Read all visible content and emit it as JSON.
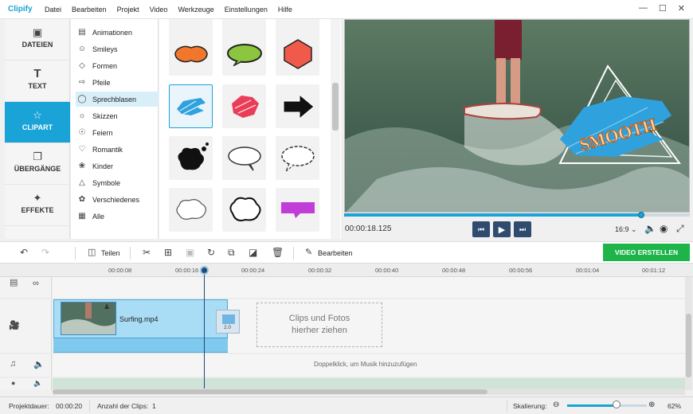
{
  "app": {
    "title": "Clipify"
  },
  "menu": [
    "Datei",
    "Bearbeiten",
    "Projekt",
    "Video",
    "Werkzeuge",
    "Einstellungen",
    "Hilfe"
  ],
  "window_controls": [
    "minimize-icon",
    "maximize-icon",
    "close-icon"
  ],
  "nav": [
    {
      "label": "DATEIEN",
      "icon": "image-icon",
      "active": false
    },
    {
      "label": "TEXT",
      "icon": "text-icon",
      "active": false
    },
    {
      "label": "CLIPART",
      "icon": "star-icon",
      "active": true
    },
    {
      "label": "ÜBERGÄNGE",
      "icon": "transition-icon",
      "active": false
    },
    {
      "label": "EFFEKTE",
      "icon": "magic-wand-icon",
      "active": false
    }
  ],
  "categories": [
    {
      "label": "Animationen",
      "icon": "film-icon"
    },
    {
      "label": "Smileys",
      "icon": "smiley-icon"
    },
    {
      "label": "Formen",
      "icon": "shapes-icon"
    },
    {
      "label": "Pfeile",
      "icon": "arrow-icon"
    },
    {
      "label": "Sprechblasen",
      "icon": "speech-bubble-icon",
      "selected": true
    },
    {
      "label": "Skizzen",
      "icon": "sketch-sun-icon"
    },
    {
      "label": "Feiern",
      "icon": "celebrate-icon"
    },
    {
      "label": "Romantik",
      "icon": "heart-icon"
    },
    {
      "label": "Kinder",
      "icon": "kids-icon"
    },
    {
      "label": "Symbole",
      "icon": "warning-icon"
    },
    {
      "label": "Verschiedenes",
      "icon": "misc-icon"
    },
    {
      "label": "Alle",
      "icon": "grid-icon"
    }
  ],
  "preview": {
    "overlay_text": "SMOOTH",
    "timecode": "00:00:18.125",
    "progress": 0.86,
    "aspect_ratio": "16:9"
  },
  "playback": [
    "skip-back-icon",
    "play-icon",
    "skip-forward-icon"
  ],
  "preview_tools": [
    "volume-icon",
    "camera-icon",
    "fullscreen-icon"
  ],
  "toolbar": {
    "undo": "undo-icon",
    "redo": "redo-icon",
    "split_label": "Teilen",
    "edit_label": "Bearbeiten",
    "create_label": "VIDEO ERSTELLEN"
  },
  "ruler": [
    "00:00:08",
    "00:00:16",
    "00:00:24",
    "00:00:32",
    "00:00:40",
    "00:00:48",
    "00:00:56",
    "00:01:04",
    "00:01:12"
  ],
  "timeline": {
    "clip_name": "Surfing.mp4",
    "transition_duration": "2.0",
    "dropzone_line1": "Clips und Fotos",
    "dropzone_line2": "hierher ziehen",
    "music_hint": "Doppelklick, um Musik hinzuzufügen"
  },
  "status": {
    "duration_label": "Projektdauer:",
    "duration_value": "00:00:20",
    "clips_label": "Anzahl der Clips:",
    "clips_value": "1",
    "zoom_label": "Skalierung:",
    "zoom_value": "62%",
    "zoom_level": 0.62
  },
  "colors": {
    "accent": "#1aa3d6",
    "create_button": "#1db54a",
    "playback_button": "#2f4c6e"
  }
}
